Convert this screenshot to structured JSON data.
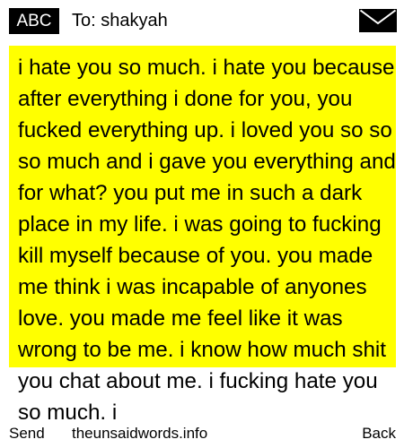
{
  "header": {
    "input_mode": "ABC",
    "recipient": "To: shakyah",
    "envelope_icon": "envelope-icon"
  },
  "message": {
    "highlight_color": "#ffff00",
    "body": "i hate you so much. i hate you because after everything i done for you, you fucked everything up. i loved you so so so much and i gave you everything and for what? you put me in such a dark place in my life. i was going to fucking kill myself because of you. you made me think i was incapable of anyones love. you made me feel like it was wrong to be me. i know how much shit you chat about me. i fucking hate you so much. i"
  },
  "softkeys": {
    "left": "Send",
    "center": "theunsaidwords.info",
    "right": "Back"
  }
}
